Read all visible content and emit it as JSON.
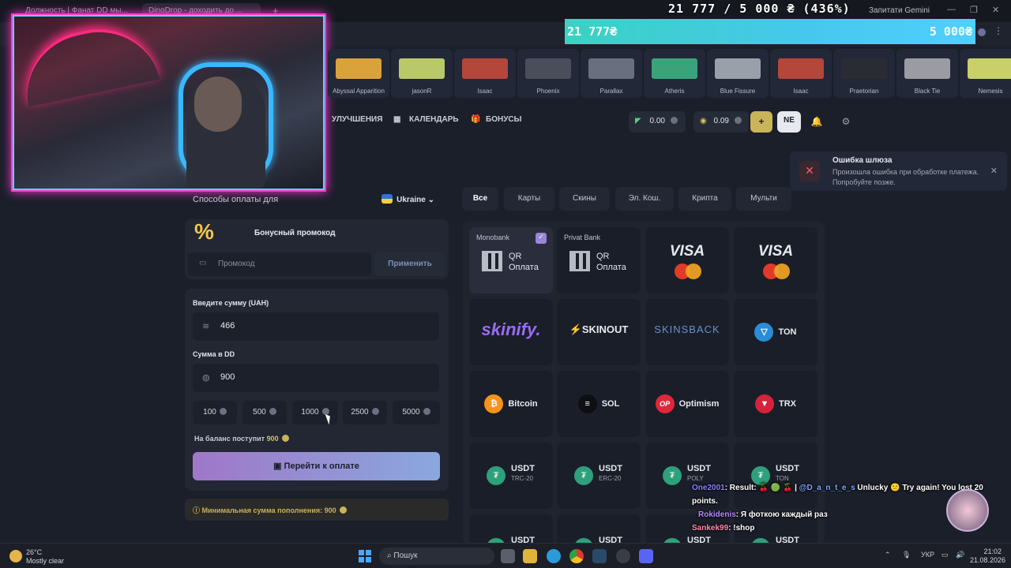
{
  "browser": {
    "tab1": "Должность | Фанат DD мы...",
    "tab2": "DinoDrop - доходить до ...",
    "gemini": "Запитати Gemini"
  },
  "donation": {
    "header": "21 777 / 5 000 ₴ (436%)",
    "bar_left": "21 777₴",
    "bar_right": "5 000₴",
    "progress_percent": 436
  },
  "skins": [
    {
      "name": "Abyssal Apparition",
      "color": "#d9a23a"
    },
    {
      "name": "jasonR",
      "color": "#b9c96a"
    },
    {
      "name": "Isaac",
      "color": "#b2473a"
    },
    {
      "name": "Phoenix",
      "color": "#4a4e5a"
    },
    {
      "name": "Parallax",
      "color": "#6a6f80"
    },
    {
      "name": "Atheris",
      "color": "#3aa37a"
    },
    {
      "name": "Blue Fissure",
      "color": "#9aa0aa"
    },
    {
      "name": "Isaac",
      "color": "#b2473a"
    },
    {
      "name": "Praetorian",
      "color": "#2a2c33"
    },
    {
      "name": "Black Tie",
      "color": "#9a9ca2"
    },
    {
      "name": "Nemesis",
      "color": "#c9d06a"
    }
  ],
  "nav": {
    "upgrades": "УЛУЧШЕНИЯ",
    "calendar": "КАЛЕНДАРЬ",
    "bonuses": "БОНУСЫ",
    "balance1": "0.00",
    "balance2": "0.09",
    "plus": "+",
    "profile": "NE"
  },
  "toast": {
    "title": "Ошибка шлюза",
    "body": "Произошла ошибка при обработке платежа. Попробуйте позже."
  },
  "left": {
    "methods_label": "Способы оплаты для",
    "country": "Ukraine",
    "promo_title": "Бонусный промокод",
    "promo_placeholder": "Промокод",
    "apply": "Применить",
    "amount_label": "Введите сумму (UAH)",
    "amount_value": "466",
    "dd_label": "Сумма в DD",
    "dd_value": "900",
    "chips": [
      "100",
      "500",
      "1000",
      "2500",
      "5000"
    ],
    "balance_label": "На баланс поступит",
    "balance_value": "900",
    "pay_button": "Перейти к оплате",
    "min_label": "Минимальная сумма пополнения:",
    "min_value": "900"
  },
  "filters": [
    "Все",
    "Карты",
    "Скины",
    "Эл. Кош.",
    "Крипта",
    "Мульти"
  ],
  "methods": {
    "monobank": "Monobank",
    "privat": "Privat Bank",
    "qr1": "QR",
    "qr2": "Оплата",
    "visa": "VISA",
    "skinify": "skinify.",
    "skinout": "SKINOUT",
    "skinsback": "SKINSBACK",
    "ton": "TON",
    "bitcoin": "Bitcoin",
    "sol": "SOL",
    "optimism": "Optimism",
    "trx": "TRX",
    "usdt": "USDT",
    "trc20": "TRC-20",
    "erc20": "ERC-20",
    "poly": "POLY",
    "ton_net": "TON"
  },
  "chat": [
    {
      "user": "One2001",
      "text": ": Result: 🍒 🟢 🍒 | ",
      "mention": "@D_a_n_t_e_s",
      "rest": " Unlucky 😕 Try again! You lost 20 points."
    },
    {
      "user": "Rokidenis",
      "text": ": Я фоткою каждый раз"
    },
    {
      "user": "Sankek99",
      "text": ": !shop"
    }
  ],
  "taskbar": {
    "temp": "26°C",
    "weather": "Mostly clear",
    "search": "Пошук",
    "lang": "УКР",
    "time": "21:02",
    "date": "21.08.2026"
  }
}
